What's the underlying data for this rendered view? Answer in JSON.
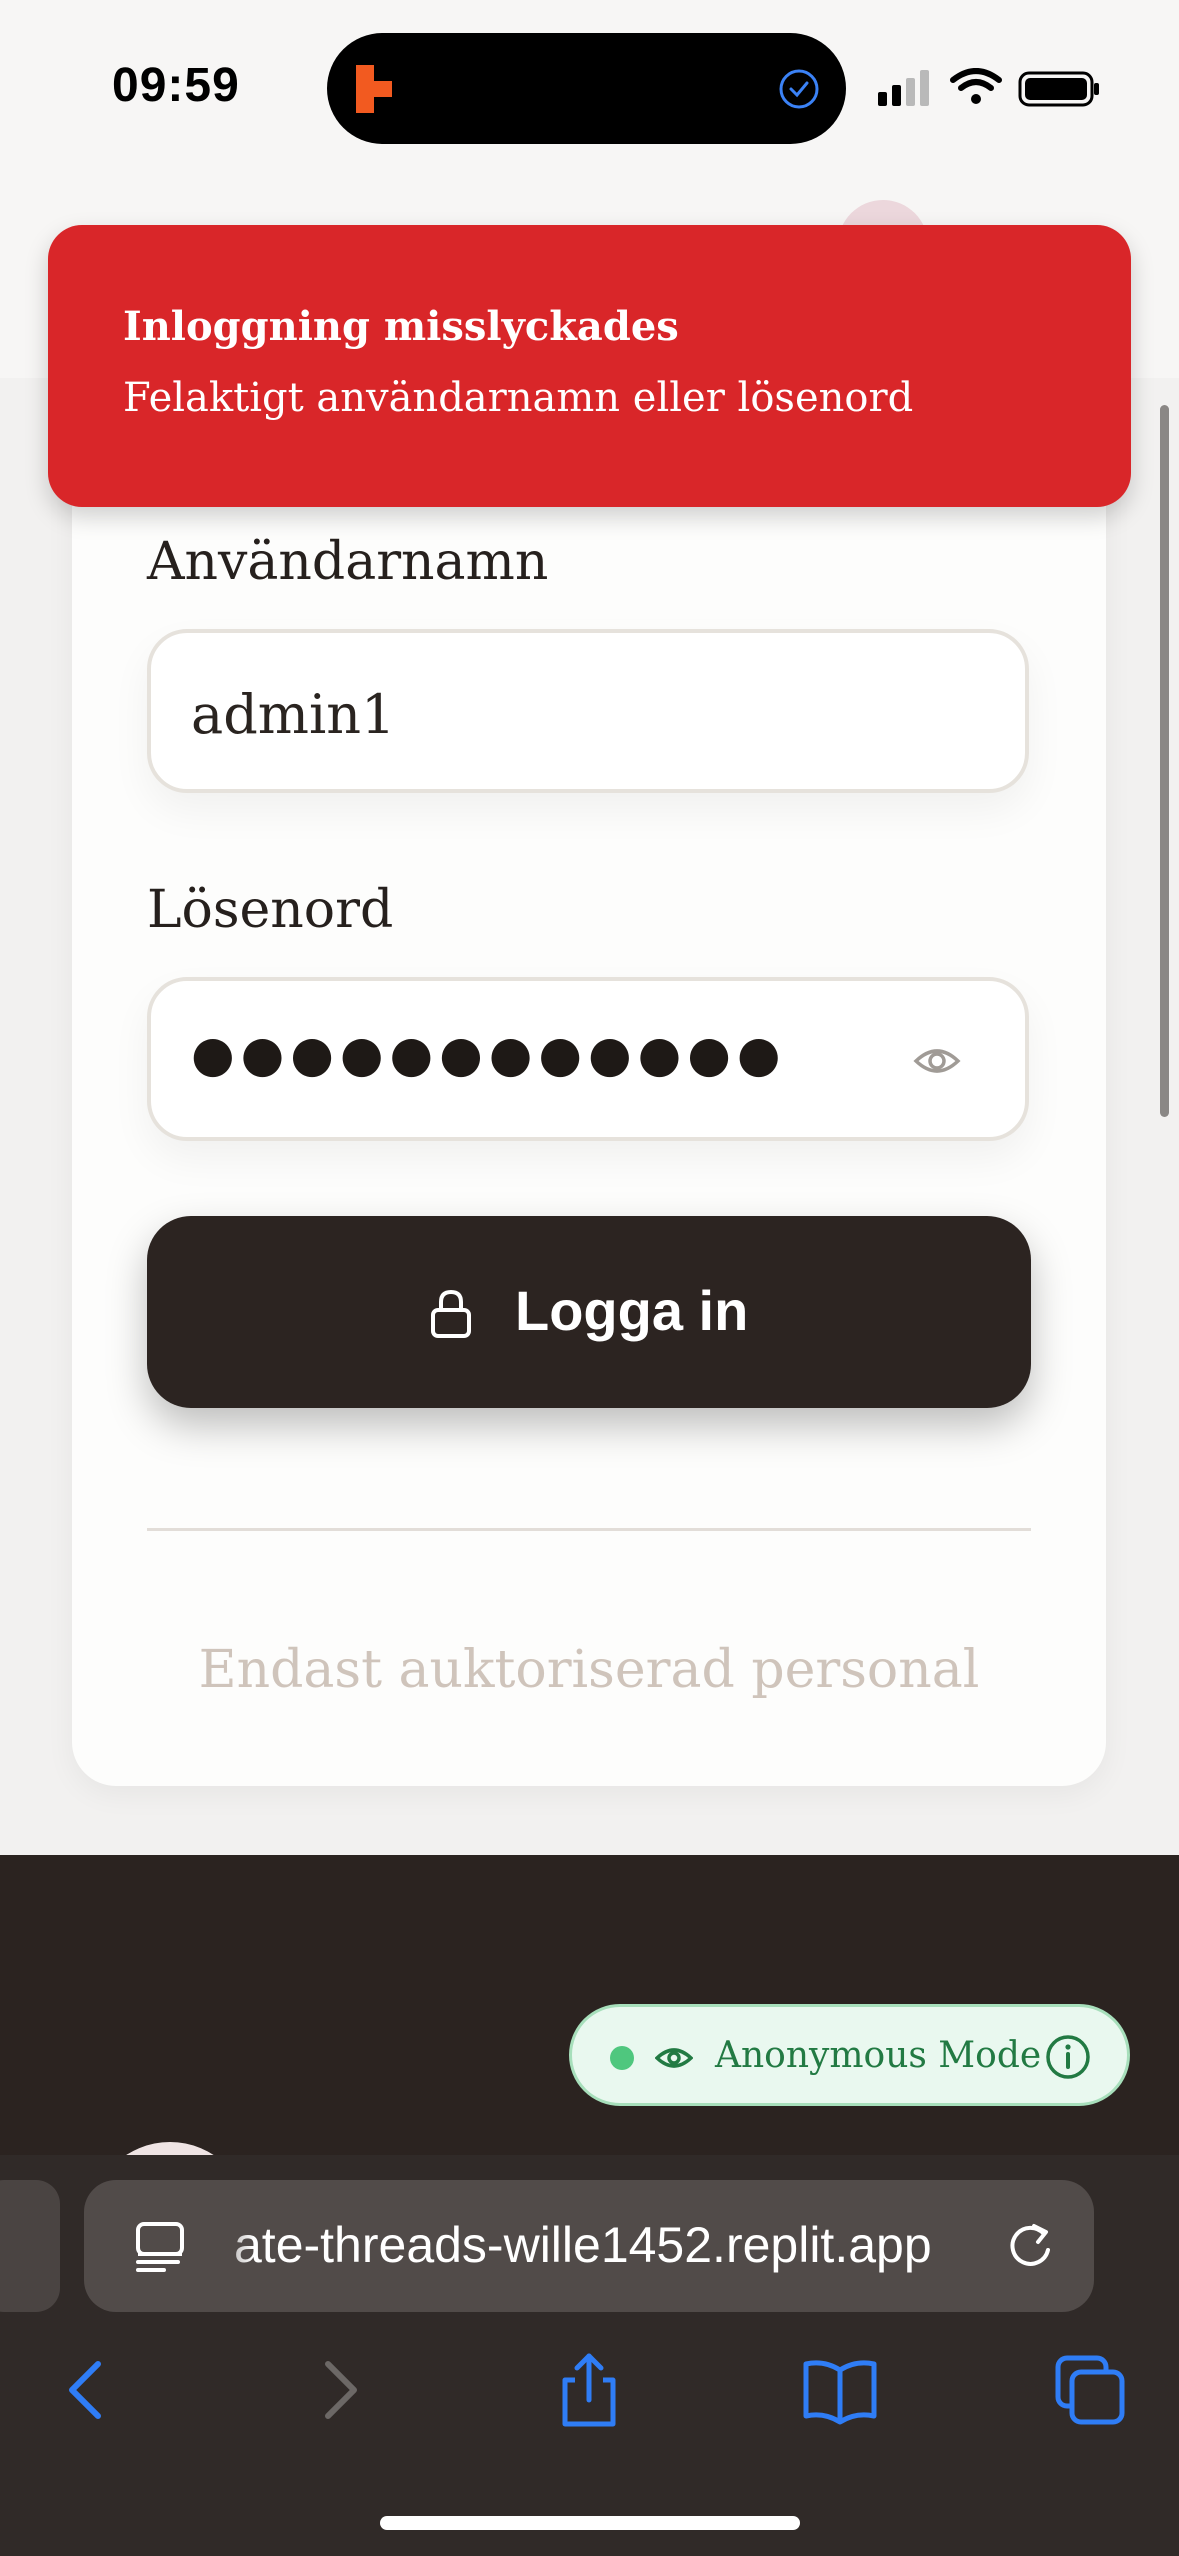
{
  "status_bar": {
    "time": "09:59"
  },
  "toast": {
    "title": "Inloggning misslyckades",
    "message": "Felaktigt användarnamn eller lösenord"
  },
  "login_form": {
    "username_label": "Användarnamn",
    "username_value": "admin1",
    "password_label": "Lösenord",
    "password_masked": "●●●●●●●●●●●●",
    "login_button_label": "Logga in",
    "footer_note": "Endast auktoriserad personal"
  },
  "anonymous_badge": {
    "label": "Anonymous Mode"
  },
  "browser": {
    "url": "ate-threads-wille1452.replit.app"
  },
  "colors": {
    "toast_red": "#d92629",
    "button_dark": "#2c2421",
    "anon_green": "#227a43",
    "safari_accent": "#2f7df6"
  },
  "icons": [
    "app-logo-icon",
    "checkmark-circle-icon",
    "signal-icon",
    "wifi-icon",
    "battery-icon",
    "eye-icon",
    "lock-icon",
    "info-icon",
    "site-settings-icon",
    "reload-icon",
    "back-arrow-icon",
    "forward-arrow-icon",
    "share-icon",
    "bookmarks-icon",
    "tabs-icon"
  ]
}
